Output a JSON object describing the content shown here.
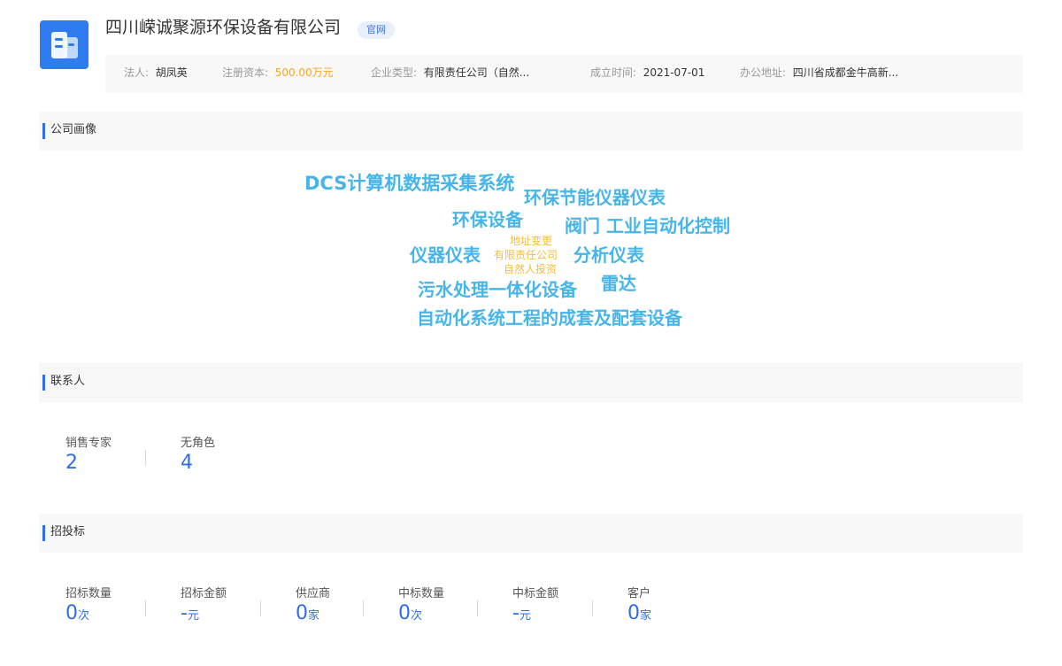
{
  "company": {
    "name": "四川嵘诚聚源环保设备有限公司",
    "official_tag": "官网",
    "logo_icon": "building-icon"
  },
  "info": {
    "legal_person_label": "法人:",
    "legal_person": "胡凤英",
    "capital_label": "注册资本:",
    "capital": "500.00万元",
    "type_label": "企业类型:",
    "type": "有限责任公司（自然...",
    "founded_label": "成立时间:",
    "founded": "2021-07-01",
    "address_label": "办公地址:",
    "address": "四川省成都金牛高新..."
  },
  "portrait": {
    "title": "公司画像",
    "words": [
      "DCS计算机数据采集系统",
      "环保节能仪器仪表",
      "环保设备",
      "阀门 工业自动化控制",
      "仪器仪表",
      "地址变更",
      "有限责任公司",
      "自然人投资",
      "分析仪表",
      "污水处理一体化设备",
      "雷达",
      "自动化系统工程的成套及配套设备"
    ]
  },
  "contacts": {
    "title": "联系人",
    "items": [
      {
        "label": "销售专家",
        "value": "2"
      },
      {
        "label": "无角色",
        "value": "4"
      }
    ]
  },
  "bidding": {
    "title": "招投标",
    "items": [
      {
        "label": "招标数量",
        "value": "0",
        "unit": "次"
      },
      {
        "label": "招标金额",
        "value": "-",
        "unit": "元"
      },
      {
        "label": "供应商",
        "value": "0",
        "unit": "家"
      },
      {
        "label": "中标数量",
        "value": "0",
        "unit": "次"
      },
      {
        "label": "中标金额",
        "value": "-",
        "unit": "元"
      },
      {
        "label": "客户",
        "value": "0",
        "unit": "家"
      }
    ]
  },
  "colors": {
    "accent": "#2f6ee6",
    "cloud_blue": "#46b5ea",
    "cloud_orange": "#f5bc3c",
    "capital_orange": "#f5a623"
  }
}
